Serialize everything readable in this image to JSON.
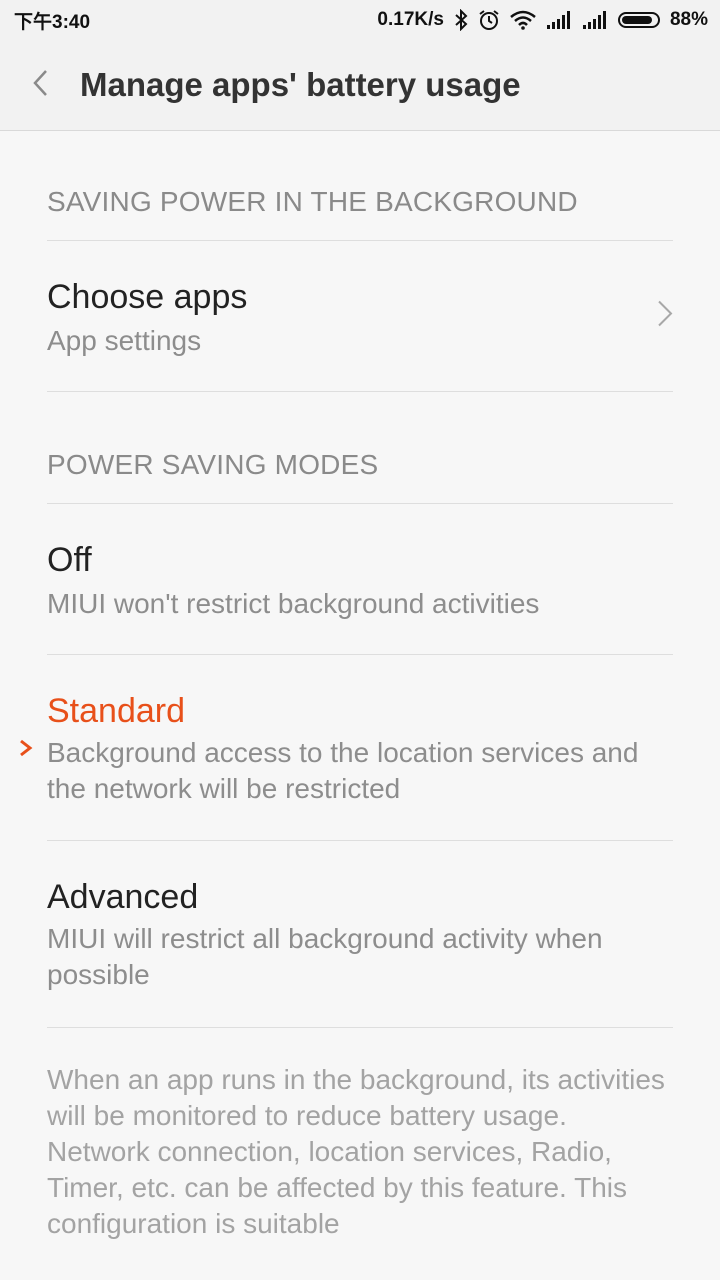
{
  "status_bar": {
    "time": "下午3:40",
    "net_speed": "0.17K/s",
    "battery_percent": "88%",
    "battery_level": 0.88,
    "icons": [
      "bluetooth-icon",
      "alarm-icon",
      "wifi-icon",
      "signal-icon",
      "signal-icon",
      "battery-icon"
    ]
  },
  "header": {
    "title": "Manage apps' battery usage",
    "back_icon": "back-chevron-icon"
  },
  "sections": {
    "background": {
      "label": "SAVING POWER IN THE BACKGROUND",
      "choose_apps": {
        "title": "Choose apps",
        "subtitle": "App settings"
      }
    },
    "modes": {
      "label": "POWER SAVING MODES",
      "off": {
        "title": "Off",
        "subtitle": "MIUI won't restrict background activities"
      },
      "standard": {
        "title": "Standard",
        "subtitle": "Background access to the location services and the network will be restricted",
        "selected": true
      },
      "advanced": {
        "title": "Advanced",
        "subtitle": "MIUI will restrict all background activity when possible"
      }
    }
  },
  "footer_note": "When an app runs in the background, its activities will be monitored to reduce battery usage. Network connection, location services, Radio, Timer, etc. can be affected by this feature. This configuration is suitable",
  "colors": {
    "accent": "#e8501a",
    "background": "#f7f7f7",
    "divider": "#dedede"
  }
}
